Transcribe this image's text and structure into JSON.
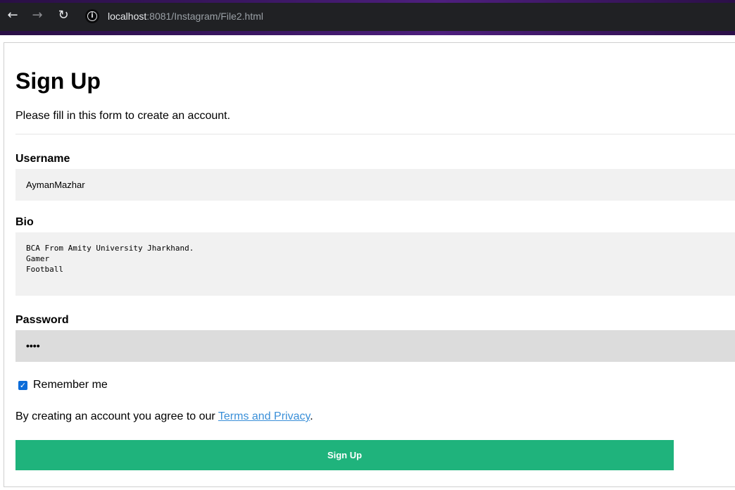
{
  "browser": {
    "url_host": "localhost",
    "url_path": ":8081/Instagram/File2.html",
    "back_glyph": "←",
    "forward_glyph": "→",
    "reload_glyph": "↻",
    "info_glyph": "i",
    "icons": [
      "back-arrow-icon",
      "forward-arrow-icon",
      "reload-icon",
      "site-info-icon"
    ]
  },
  "form": {
    "title": "Sign Up",
    "intro": "Please fill in this form to create an account.",
    "username_label": "Username",
    "username_value": "AymanMazhar",
    "bio_label": "Bio",
    "bio_value": "BCA From Amity University Jharkhand.\nGamer\nFootball",
    "password_label": "Password",
    "password_mask": "••••",
    "remember_label": "Remember me",
    "remember_checked": true,
    "checkmark_glyph": "✓",
    "terms_text": "By creating an account you agree to our ",
    "terms_link": "Terms and Privacy",
    "terms_end": ".",
    "submit_label": "Sign Up"
  },
  "colors": {
    "primary_button": "#1fb37c",
    "link": "#3a8fd8",
    "input_bg": "#f1f1f1",
    "password_bg": "#dcdcdc",
    "checkbox": "#0b6cd9"
  }
}
